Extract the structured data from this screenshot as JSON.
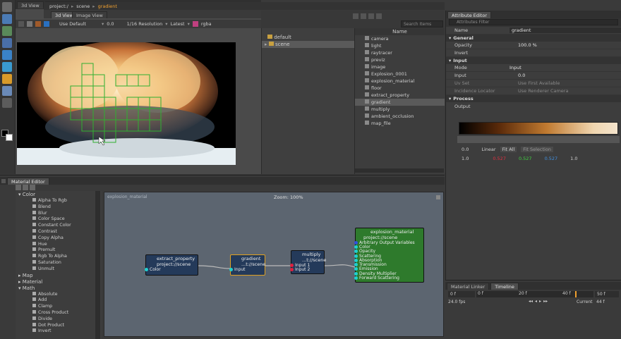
{
  "viewport": {
    "tabs": [
      "3d View",
      "Image View"
    ],
    "breadcrumb": [
      "project:/",
      "scene",
      "gradient"
    ],
    "toolbar": {
      "display_mode": "Use Default",
      "value": "0.0",
      "resolution": "1/16 Resolution",
      "version": "Latest",
      "channel": "rgba"
    }
  },
  "scene_tree": {
    "items": [
      "default",
      "scene"
    ]
  },
  "node_list": {
    "search_placeholder": "Search Items",
    "header": "Name",
    "items": [
      "camera",
      "light",
      "raytracer",
      "previz",
      "image",
      "Explosion_0001",
      "explosion_material",
      "floor",
      "extract_property",
      "gradient",
      "multiply",
      "ambient_occlusion",
      "map_file"
    ]
  },
  "attribute_editor": {
    "tab": "Attribute Editor",
    "filter_placeholder": "Attributes Filter",
    "name_label": "Name",
    "name_value": "gradient",
    "sections": {
      "general": "General",
      "input": "Input",
      "process": "Process"
    },
    "opacity_label": "Opacity",
    "opacity_value": "100.0 %",
    "invert_label": "Invert",
    "mode_label": "Mode",
    "mode_value": "Input",
    "input_label": "Input",
    "input_value": "0.0",
    "uv_set_label": "Uv Set",
    "uv_set_value": "Use First Available",
    "incidence_label": "Incidence Locator",
    "incidence_value": "Use Renderer Camera",
    "output_label": "Output",
    "pos_value": "0.0",
    "interp": "Linear",
    "fit_all": "Fit All",
    "fit_selection": "Fit Selection",
    "alpha_value": "1.0",
    "rgb": [
      "0.527",
      "0.527",
      "0.527"
    ],
    "a_value": "1.0"
  },
  "material_editor": {
    "tab": "Material Editor",
    "graph_title": "explosion_material",
    "zoom": "Zoom: 100%",
    "categories": {
      "color": "Color",
      "color_items": [
        "Alpha To Rgb",
        "Blend",
        "Blur",
        "Color Space",
        "Constant Color",
        "Contrast",
        "Copy Alpha",
        "Hue",
        "Premult",
        "Rgb To Alpha",
        "Saturation",
        "Unmult"
      ],
      "map": "Map",
      "material": "Material",
      "math": "Math",
      "math_items": [
        "Absolute",
        "Add",
        "Clamp",
        "Cross Product",
        "Divide",
        "Dot Product",
        "Invert"
      ]
    },
    "nodes": {
      "extract": {
        "title": "extract_property",
        "path": "project://scene",
        "ports": [
          "Color"
        ]
      },
      "gradient": {
        "title": "gradient",
        "path": "...t://scene",
        "ports": [
          "Input"
        ]
      },
      "multiply": {
        "title": "multiply",
        "path": "...t://scene",
        "ports": [
          "Input 1",
          "Input 2"
        ]
      },
      "material": {
        "title": "explosion_material",
        "path": "project://scene",
        "ports": [
          "Arbitrary Output Variables",
          "Color",
          "Opacity",
          "Scattering",
          "Absorption",
          "Transmission",
          "Emission",
          "Density Multiplier",
          "Forward Scattering"
        ]
      }
    }
  },
  "timeline": {
    "tabs": [
      "Material Linker",
      "Timeline"
    ],
    "start": "0 f",
    "ticks": [
      "0 f",
      "20 f",
      "40 f"
    ],
    "end": "50 f",
    "fps": "24.0 fps",
    "current_label": "Current",
    "current_value": "44 f"
  }
}
